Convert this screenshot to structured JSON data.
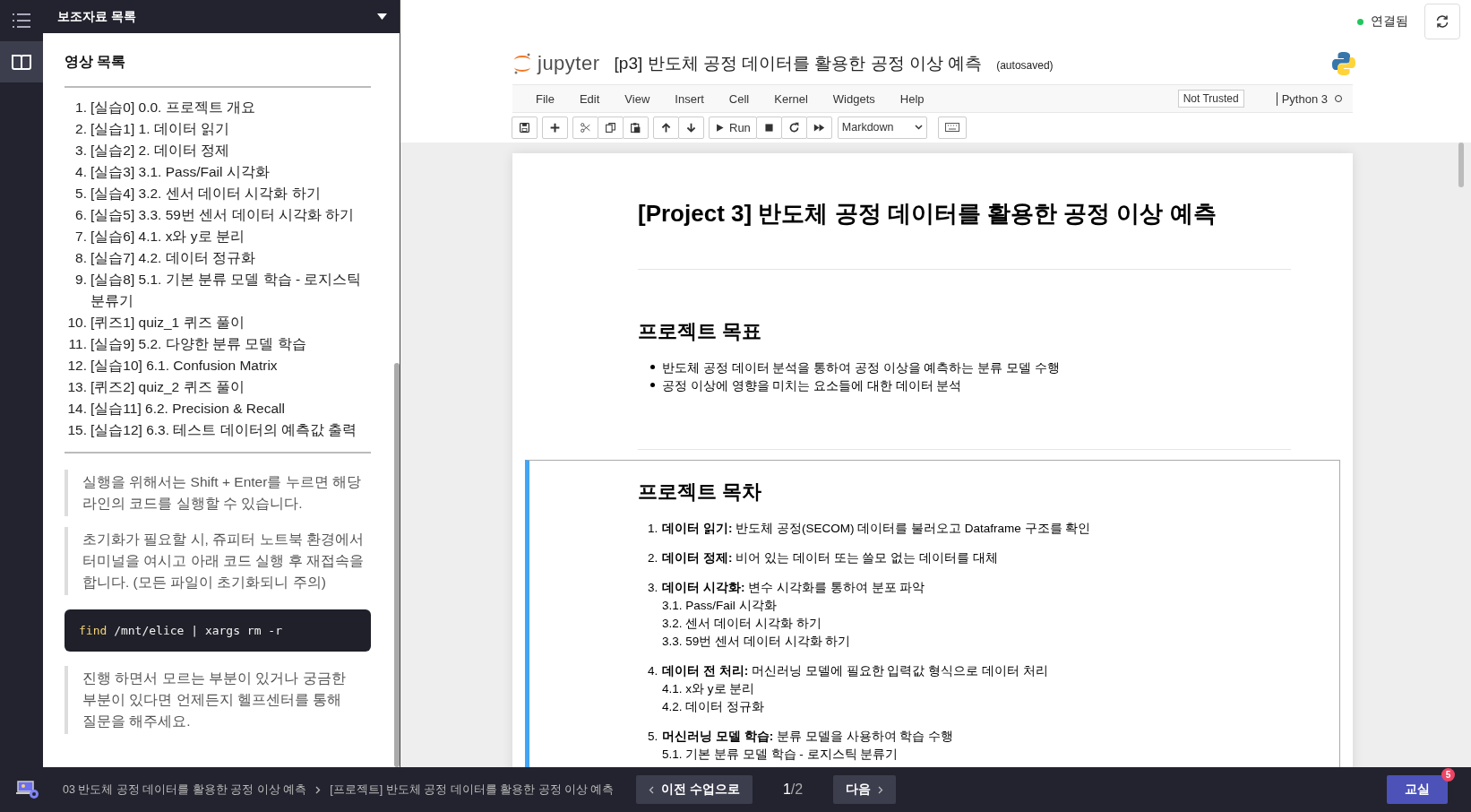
{
  "rail": {
    "items": [
      {
        "kind": "menu",
        "selected": false
      },
      {
        "kind": "book",
        "selected": true
      }
    ]
  },
  "panel": {
    "title": "보조자료 목록",
    "section_title": "영상 목록",
    "videos": [
      {
        "number": "1.",
        "title": "[실습0] 0.0. 프로젝트 개요"
      },
      {
        "number": "2.",
        "title": "[실습1] 1. 데이터 읽기"
      },
      {
        "number": "3.",
        "title": "[실습2] 2. 데이터 정제"
      },
      {
        "number": "4.",
        "title": "[실습3] 3.1. Pass/Fail 시각화"
      },
      {
        "number": "5.",
        "title": "[실습4] 3.2. 센서 데이터 시각화 하기"
      },
      {
        "number": "6.",
        "title": "[실습5] 3.3. 59번 센서 데이터 시각화 하기"
      },
      {
        "number": "7.",
        "title": "[실습6] 4.1. x와 y로 분리"
      },
      {
        "number": "8.",
        "title": "[실습7] 4.2. 데이터 정규화"
      },
      {
        "number": "9.",
        "title": "[실습8] 5.1. 기본 분류 모델 학습 - 로지스틱 분류기"
      },
      {
        "number": "10.",
        "title": "[퀴즈1] quiz_1 퀴즈 풀이"
      },
      {
        "number": "11.",
        "title": "[실습9] 5.2. 다양한 분류 모델 학습"
      },
      {
        "number": "12.",
        "title": "[실습10] 6.1. Confusion Matrix"
      },
      {
        "number": "13.",
        "title": "[퀴즈2] quiz_2 퀴즈 풀이"
      },
      {
        "number": "14.",
        "title": "[실습11] 6.2. Precision & Recall"
      },
      {
        "number": "15.",
        "title": "[실습12] 6.3. 테스트 데이터의 예측값 출력"
      }
    ],
    "notes": [
      {
        "kind": "quote",
        "text": "실행을 위해서는 Shift + Enter를 누르면 해당 라인의 코드를 실행할 수 있습니다."
      },
      {
        "kind": "quote",
        "text": "초기화가 필요할 시, 쥬피터 노트북 환경에서 터미널을 여시고 아래 코드 실행 후 재접속을 합니다. (모든 파일이 초기화되니 주의)"
      },
      {
        "kind": "code",
        "tokens": [
          {
            "kind": "command",
            "text": "find"
          },
          {
            "kind": "plain",
            "text": " /mnt/elice | xargs rm -r"
          }
        ]
      },
      {
        "kind": "quote",
        "text": "진행 하면서 모르는 부분이 있거나 궁금한 부분이 있다면 언제든지 헬프센터를 통해 질문을 해주세요."
      }
    ]
  },
  "connection": {
    "label": "연결됨",
    "connected": true
  },
  "jupyter": {
    "logo_text": "jupyter",
    "title": "[p3] 반도체 공정 데이터를 활용한 공정 이상 예측",
    "save_status": "(autosaved)",
    "menu": [
      "File",
      "Edit",
      "View",
      "Insert",
      "Cell",
      "Kernel",
      "Widgets",
      "Help"
    ],
    "trust": "Not Trusted",
    "kernel": "Python 3",
    "kernel_busy": false,
    "toolbar": [
      [
        {
          "kind": "save"
        }
      ],
      [
        {
          "kind": "plus"
        }
      ],
      [
        {
          "kind": "cut"
        },
        {
          "kind": "copy"
        },
        {
          "kind": "paste"
        }
      ],
      [
        {
          "kind": "up"
        },
        {
          "kind": "down"
        }
      ],
      [
        {
          "kind": "run",
          "label": "Run"
        },
        {
          "kind": "stop"
        },
        {
          "kind": "restart"
        },
        {
          "kind": "fast-forward"
        }
      ]
    ],
    "cell_type": "Markdown"
  },
  "cells": [
    {
      "selected": false,
      "blocks": [
        {
          "kind": "h1",
          "text": "[Project 3] 반도체 공정 데이터를 활용한 공정 이상 예측"
        },
        {
          "kind": "rule"
        },
        {
          "kind": "h2",
          "text": "프로젝트 목표"
        },
        {
          "kind": "bullets",
          "items": [
            "반도체 공정 데이터 분석을 통하여 공정 이상을 예측하는 분류 모델 수행",
            "공정 이상에 영향을 미치는 요소들에 대한 데이터 분석"
          ]
        },
        {
          "kind": "rule"
        }
      ]
    },
    {
      "selected": true,
      "blocks": [
        {
          "kind": "h2",
          "text": "프로젝트 목차"
        },
        {
          "kind": "numbered",
          "items": [
            {
              "number": "1.",
              "text": "**데이터 읽기:** 반도체 공정(SECOM) 데이터를 불러오고 Dataframe 구조를 확인"
            },
            {
              "number": "2.",
              "text": "**데이터 정제:** 비어 있는 데이터 또는 쓸모 없는 데이터를 대체"
            },
            {
              "number": "3.",
              "text": "**데이터 시각화:** 변수 시각화를 통하여 분포 파악",
              "children": [
                "3.1. Pass/Fail 시각화",
                "3.2. 센서 데이터 시각화 하기",
                "3.3. 59번 센서 데이터 시각화 하기"
              ]
            },
            {
              "number": "4.",
              "text": "**데이터 전 처리:** 머신러닝 모델에 필요한 입력값 형식으로 데이터 처리",
              "children": [
                "4.1. x와 y로 분리",
                "4.2. 데이터 정규화"
              ]
            },
            {
              "number": "5.",
              "text": "**머신러닝 모델 학습:** 분류 모델을 사용하여 학습 수행",
              "children": [
                "5.1. 기본 분류 모델 학습 - 로지스틱 분류기"
              ]
            }
          ]
        }
      ]
    }
  ],
  "footer": {
    "breadcrumb": [
      "03 반도체 공정 데이터를 활용한 공정 이상 예측",
      "[프로젝트] 반도체 공정 데이터를 활용한 공정 이상 예측"
    ],
    "prev": "이전 수업으로",
    "page_current": "1",
    "page_total": "/2",
    "next": "다음",
    "classroom": "교실",
    "classroom_badge": "5"
  }
}
